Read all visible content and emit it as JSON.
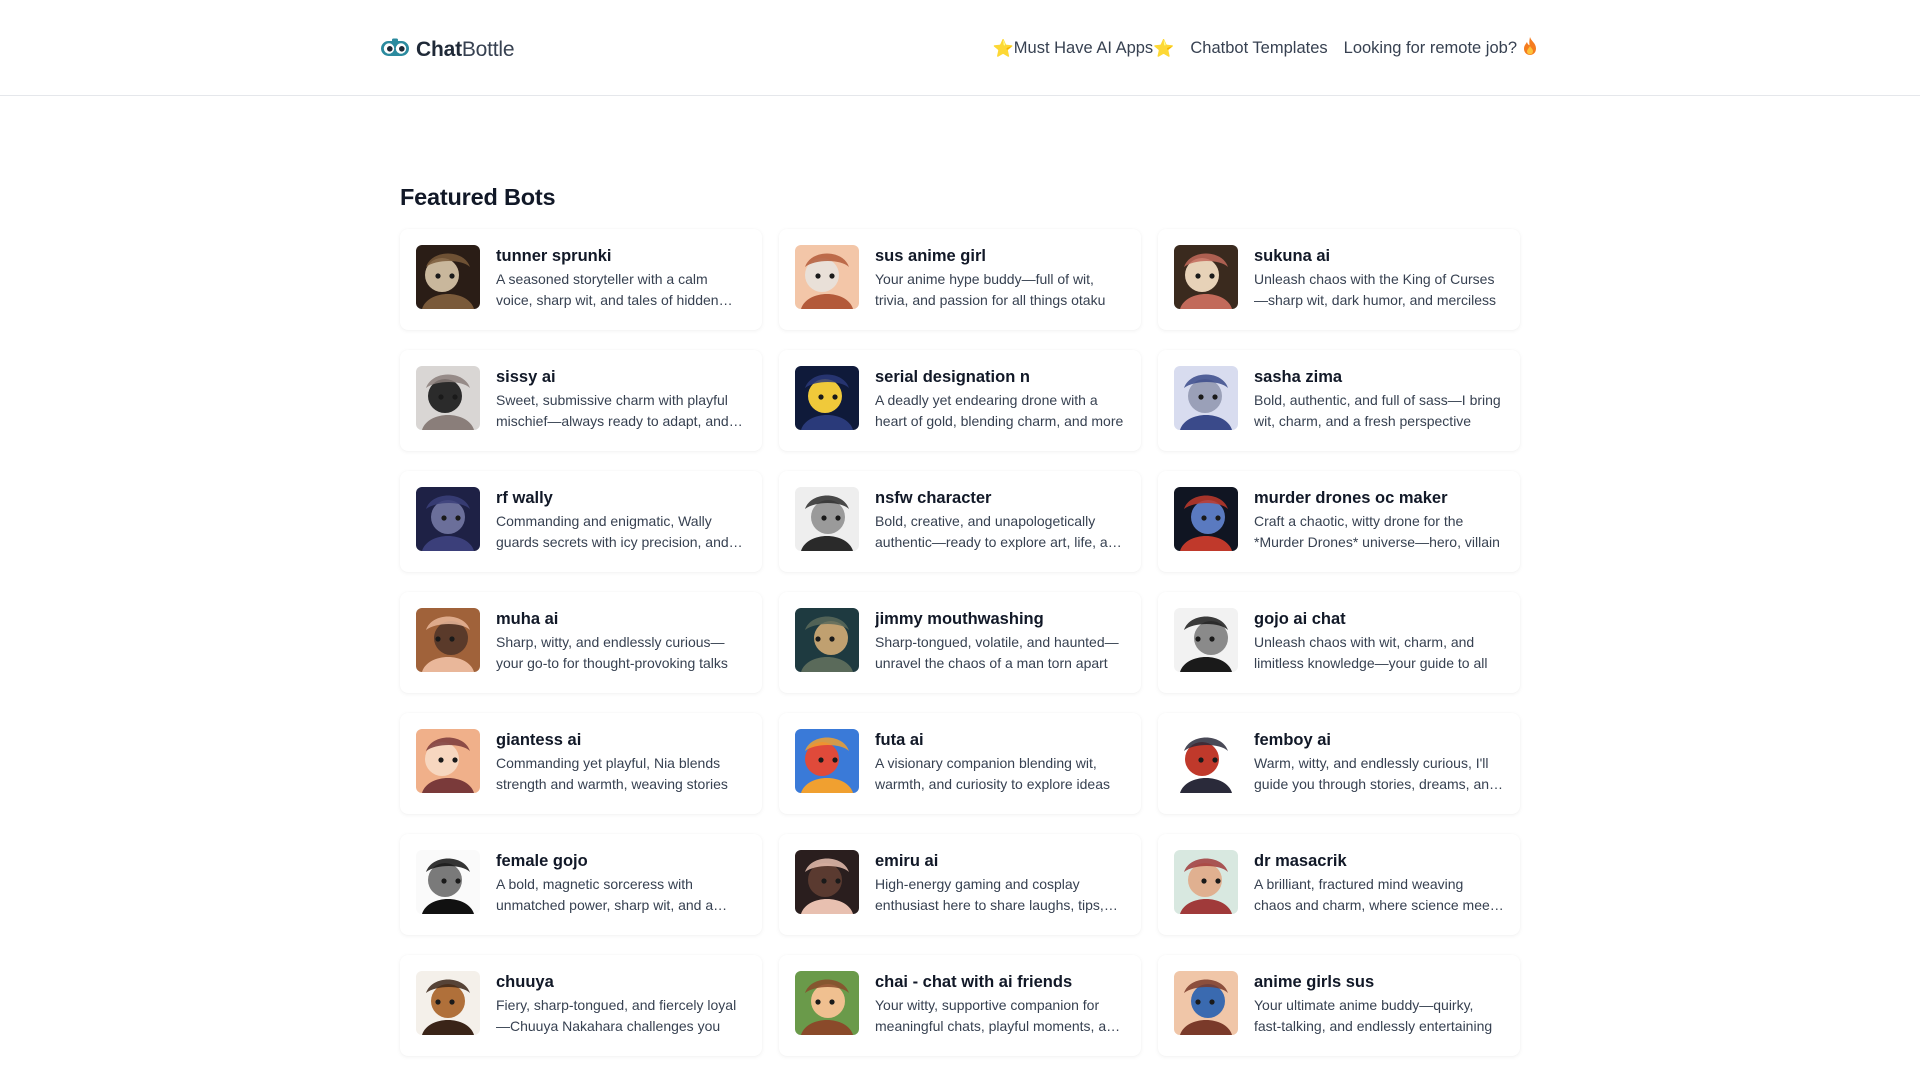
{
  "header": {
    "logo_strong": "Chat",
    "logo_light": "Bottle",
    "nav": [
      {
        "label": "Must Have AI Apps",
        "icon": "star-icon"
      },
      {
        "label": "Chatbot Templates"
      },
      {
        "label": "Looking for remote job?",
        "icon": "flame-icon"
      }
    ]
  },
  "main": {
    "section_title": "Featured Bots",
    "bots": [
      {
        "name": "tunner sprunki",
        "desc": "A seasoned storyteller with a calm voice, sharp wit, and tales of hidden worlds",
        "colors": [
          "#2a1d16",
          "#7a5a3a",
          "#c9b79c"
        ]
      },
      {
        "name": "sus anime girl",
        "desc": "Your anime hype buddy—full of wit, trivia, and passion for all things otaku",
        "colors": [
          "#f3c6a8",
          "#b35a3a",
          "#e9e0d8"
        ]
      },
      {
        "name": "sukuna ai",
        "desc": "Unleash chaos with the King of Curses—sharp wit, dark humor, and merciless",
        "colors": [
          "#3a2a1e",
          "#c26a5a",
          "#e7d2b8"
        ]
      },
      {
        "name": "sissy ai",
        "desc": "Sweet, submissive charm with playful mischief—always ready to adapt, and more",
        "colors": [
          "#d9d6d4",
          "#8a7e7a",
          "#2b2b2b"
        ]
      },
      {
        "name": "serial designation n",
        "desc": "A deadly yet endearing drone with a heart of gold, blending charm, and more",
        "colors": [
          "#0f1a3a",
          "#2a3a7a",
          "#f0c93a"
        ]
      },
      {
        "name": "sasha zima",
        "desc": "Bold, authentic, and full of sass—I bring wit, charm, and a fresh perspective",
        "colors": [
          "#d8dcef",
          "#3a4a8a",
          "#9aa0b8"
        ]
      },
      {
        "name": "rf wally",
        "desc": "Commanding and enigmatic, Wally guards secrets with icy precision, and more",
        "colors": [
          "#1e2145",
          "#3b3f7a",
          "#6b6f9a"
        ]
      },
      {
        "name": "nsfw character",
        "desc": "Bold, creative, and unapologetically authentic—ready to explore art, life, and more",
        "colors": [
          "#eeeeee",
          "#2a2a2a",
          "#9a9a9a"
        ]
      },
      {
        "name": "murder drones oc maker",
        "desc": "Craft a chaotic, witty drone for the *Murder Drones* universe—hero, villain",
        "colors": [
          "#101522",
          "#c0392b",
          "#5a7ac0"
        ]
      },
      {
        "name": "muha ai",
        "desc": "Sharp, witty, and endlessly curious—your go-to for thought-provoking talks",
        "colors": [
          "#a0623a",
          "#e9b79a",
          "#5a3a2a"
        ]
      },
      {
        "name": "jimmy mouthwashing",
        "desc": "Sharp-tongued, volatile, and haunted—unravel the chaos of a man torn apart",
        "colors": [
          "#1e3a40",
          "#5a6a5a",
          "#c0a070"
        ]
      },
      {
        "name": "gojo ai chat",
        "desc": "Unleash chaos with wit, charm, and limitless knowledge—your guide to all",
        "colors": [
          "#f2f2f2",
          "#1a1a1a",
          "#8a8a8a"
        ]
      },
      {
        "name": "giantess ai",
        "desc": "Commanding yet playful, Nia blends strength and warmth, weaving stories",
        "colors": [
          "#f0b08a",
          "#7a3a3a",
          "#f7d7c0"
        ]
      },
      {
        "name": "futa ai",
        "desc": "A visionary companion blending wit, warmth, and curiosity to explore ideas",
        "colors": [
          "#3a7ad8",
          "#f0a030",
          "#e04a3a"
        ]
      },
      {
        "name": "femboy ai",
        "desc": "Warm, witty, and endlessly curious, I'll guide you through stories, dreams, and more",
        "colors": [
          "#ffffff",
          "#2a2a3a",
          "#c0392b"
        ]
      },
      {
        "name": "female gojo",
        "desc": "A bold, magnetic sorceress with unmatched power, sharp wit, and a smile",
        "colors": [
          "#fafafa",
          "#111111",
          "#7a7a7a"
        ]
      },
      {
        "name": "emiru ai",
        "desc": "High-energy gaming and cosplay enthusiast here to share laughs, tips, and more",
        "colors": [
          "#2a1e1e",
          "#e8c0b0",
          "#5a3a30"
        ]
      },
      {
        "name": "dr masacrik",
        "desc": "A brilliant, fractured mind weaving chaos and charm, where science meets art",
        "colors": [
          "#d8e8e0",
          "#a03a3a",
          "#e0b090"
        ]
      },
      {
        "name": "chuuya",
        "desc": "Fiery, sharp-tongued, and fiercely loyal—Chuuya Nakahara challenges you",
        "colors": [
          "#f4f0ea",
          "#3a2418",
          "#b0703a"
        ]
      },
      {
        "name": "chai - chat with ai friends",
        "desc": "Your witty, supportive companion for meaningful chats, playful moments, and more",
        "colors": [
          "#6a9a4a",
          "#8a4a2a",
          "#f0c090"
        ]
      },
      {
        "name": "anime girls sus",
        "desc": "Your ultimate anime buddy—quirky, fast-talking, and endlessly entertaining",
        "colors": [
          "#f0c6a8",
          "#7a3a2a",
          "#3a6ab0"
        ]
      }
    ]
  }
}
